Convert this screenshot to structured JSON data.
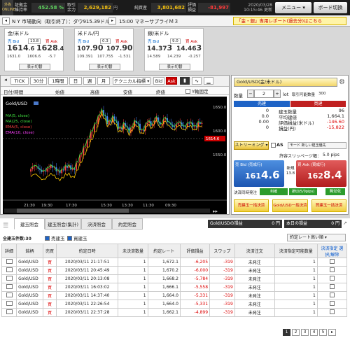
{
  "topbar": {
    "logo": "外為ONLINE",
    "ratio_label1": "証拠金",
    "ratio_label2": "維持率",
    "ratio_value": "452.58 %",
    "margin_label1": "取引",
    "margin_label2": "余力",
    "margin_value": "2,629,182",
    "equity_label": "純資産",
    "equity_value": "3,801,682",
    "pl_label1": "評価",
    "pl_label2": "損益",
    "pl_value": "-81,997",
    "yen": "円",
    "datetime": "2020/03/28",
    "time": "10:15:46 更新",
    "menu_label": "メニュー ▾",
    "board_label": "ボード切換"
  },
  "news": {
    "item1": "N Y 市場動向（取引終了）：ダウ915.39ドル安",
    "item2": "15:00 マネーサプライＭ３",
    "banner": "「金・銀」専用レポート(過去分)はこちら"
  },
  "rate_panels": [
    {
      "title": "金/米ドル",
      "bid_lbl": "売 Bid",
      "spread": "13.8",
      "ask_lbl": "買 Ask",
      "bid_main": "1614",
      "bid_big": ".6",
      "ask_main": "1628",
      "ask_big": ".4",
      "high": "1631.0",
      "low": "1606.6",
      "change": "-5.7",
      "btn": "表示切替"
    },
    {
      "title": "米ドル/円",
      "bid_lbl": "売 Bid",
      "spread": "0.3",
      "ask_lbl": "買 Ask",
      "bid_main": "107.",
      "bid_big": "90",
      "ask_main": "107.",
      "ask_big": "90",
      "high": "109.391",
      "low": "107.755",
      "change": "-1.531",
      "btn": "表示切替"
    },
    {
      "title": "銀/米ドル",
      "bid_lbl": "売 Bid",
      "spread": "9.0",
      "ask_lbl": "買 Ask",
      "bid_main": "14.37",
      "bid_big": "3",
      "ask_main": "14.46",
      "ask_big": "3",
      "high": "14.589",
      "low": "14.239",
      "change": "-0.257",
      "btn": "表示切替"
    }
  ],
  "chart": {
    "toolbar": [
      "TICK",
      "30分",
      "1時間",
      "日",
      "週",
      "月",
      "テクニカル指標 ▾",
      "Bid",
      "Ask"
    ],
    "tabs": [
      "日付/時間",
      "始値",
      "高値",
      "安値",
      "終値",
      "Y軸固定"
    ],
    "symbol": "Gold/USD",
    "legend": [
      "MA(5, close)",
      "MA(25, close)",
      "EMA(5, close)",
      "EMA(10, close)"
    ],
    "y_ticks": [
      "1650.0",
      "1600.0",
      "1550.0"
    ],
    "x_ticks": [
      "21:30",
      "19:30",
      "17:30",
      "15:30",
      "13:30",
      "11:30",
      "09:30"
    ],
    "current_price": "1614.6"
  },
  "order": {
    "pair": "Gold/USD(金/米ドル)",
    "qty_label": "数量",
    "qty": "2",
    "unit": "lot",
    "max_label": "取引可能数量",
    "max": "300",
    "sell": "売建",
    "buy": "買建",
    "rows": [
      [
        "0",
        "建玉数量",
        "96"
      ],
      [
        "0.0",
        "平均建値",
        "1,664.1"
      ],
      [
        "0.00",
        "評価損益(米ドル)",
        "-146.60"
      ],
      [
        "0",
        "損益(円)",
        "-15,822"
      ]
    ],
    "streaming": "ストリーミング ▾",
    "as_label": "AS",
    "as_text": "モード 新しい建玉優先",
    "slip_label": "許容スリッページ幅：",
    "slip_value": "5.0 pips",
    "bid_head": "売 Bid (売成行)",
    "ask_head": "買 Ask (買成行)",
    "mid_label": "新規",
    "mid_val": "13.8",
    "bid_main": "161",
    "bid_big": "4.6",
    "ask_main": "162",
    "ask_big": "8.4",
    "settle_label": "決済同時発注",
    "settle_btn1": "利確(5/10.0pips)",
    "settle_btn2": "損切(5/0pips)",
    "settle_btn3": "無効化",
    "btn1": "売建玉一括決済",
    "btn2": "Gold/USD一括決済",
    "btn3": "買建玉一括決済"
  },
  "bottom": {
    "tabs": [
      "建玉照会",
      "建玉照会(集計)",
      "決済照会",
      "約定照会"
    ],
    "pl_box_label": "Gold/USDの損益",
    "pl_box_val": "0 円",
    "today_label": "本日の損益",
    "today_val": "0 円",
    "count_label": "全建玉件数:30",
    "chk1": "売建玉",
    "chk2": "買建玉",
    "sort": "約定レート高い順 ▾",
    "headers": [
      "詳細",
      "銘柄",
      "売買",
      "約定日時",
      "未決済数量",
      "約定レート",
      "評価損益",
      "スワップ",
      "決済注文",
      "決済指定可能数量",
      "決済指定 選択/解除"
    ],
    "rows": [
      [
        "Gold/USD",
        "買",
        "2020/03/11 21:17:51",
        "1",
        "1,672.1",
        "-6,205",
        "-319",
        "未発注",
        "1"
      ],
      [
        "Gold/USD",
        "買",
        "2020/03/11 20:45:49",
        "1",
        "1,670.2",
        "-6,000",
        "-319",
        "未発注",
        "1"
      ],
      [
        "Gold/USD",
        "買",
        "2020/03/11 20:13:08",
        "1",
        "1,668.2",
        "-5,784",
        "-319",
        "未発注",
        "1"
      ],
      [
        "Gold/USD",
        "買",
        "2020/03/11 16:03:02",
        "1",
        "1,666.1",
        "-5,558",
        "-319",
        "未発注",
        "1"
      ],
      [
        "Gold/USD",
        "買",
        "2020/03/11 14:37:40",
        "1",
        "1,664.0",
        "-5,331",
        "-319",
        "未発注",
        "1"
      ],
      [
        "Gold/USD",
        "買",
        "2020/03/11 22:26:54",
        "1",
        "1,664.0",
        "-5,331",
        "-319",
        "未発注",
        "1"
      ],
      [
        "Gold/USD",
        "買",
        "2020/03/11 22:37:28",
        "1",
        "1,662.1",
        "-4,899",
        "-319",
        "未発注",
        "1"
      ]
    ],
    "pages": [
      "1",
      "2",
      "3",
      "4",
      "5"
    ]
  }
}
